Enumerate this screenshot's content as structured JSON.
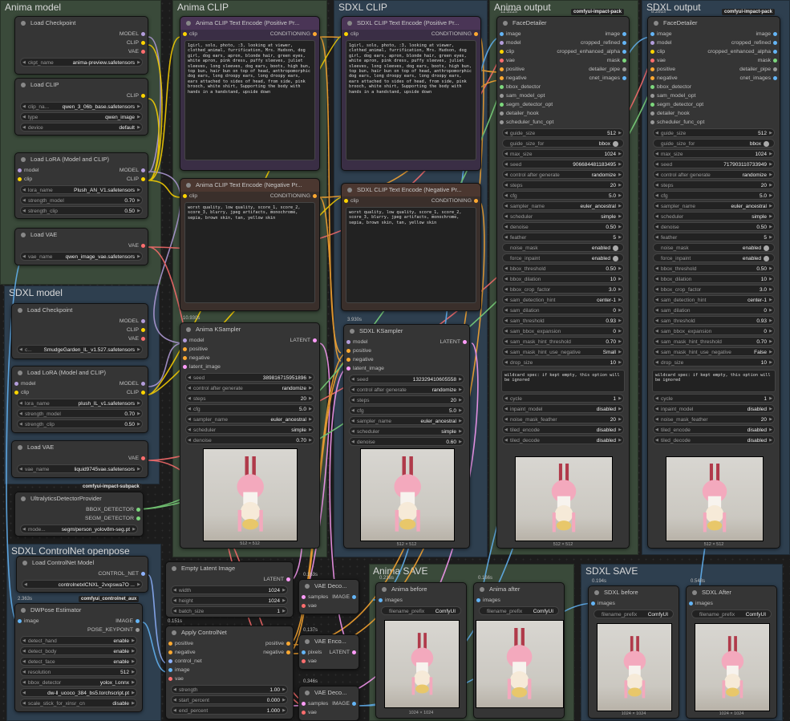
{
  "colors": {
    "model": "#b39ddb",
    "clip": "#ffd500",
    "vae": "#ff6e6e",
    "conditioning": "#ffa931",
    "latent": "#ff9cf9",
    "image": "#64b5f6",
    "bbox": "#7dd87d",
    "control": "#8fb3ff"
  },
  "groups": {
    "anima_model": "Anima model",
    "anima_clip": "Anima CLIP",
    "sdxl_clip": "SDXL CLIP",
    "anima_output": "Anima output",
    "sdxl_output": "SDXL output",
    "sdxl_model": "SDXL model",
    "sdxl_controlnet": "SDXL ControlNet openpose",
    "anima_save": "Anima SAVE",
    "sdxl_save": "SDXL SAVE"
  },
  "tags": {
    "impact_pack": "comfyui-impact-pack",
    "impact_subpack": "comfyui-impact-subpack",
    "controlnet_aux": "comfyui_controlnet_aux"
  },
  "times": {
    "anima_output": "11.522s",
    "sdxl_output": "8.281s",
    "anima_ks": "10.930s",
    "sdxl_ks": "3.930s",
    "dwpose": "2.363s",
    "ctrlnet": "0.151s",
    "vae1": "0.163s",
    "vae2": "0.137s",
    "vae3": "0.346s",
    "anima_before": "0.216s",
    "anima_after": "0.166s",
    "sdxl_before": "0.194s",
    "sdxl_after": "0.548s"
  },
  "am": {
    "ckpt_title": "Load Checkpoint",
    "ckpt_out": [
      "MODEL",
      "CLIP",
      "VAE"
    ],
    "ckpt_name_k": "ckpt_name",
    "ckpt_name_v": "anima-preview.safetensors",
    "clip_title": "Load CLIP",
    "clip_out": "CLIP",
    "clip_name_k": "clip_na...",
    "clip_name_v": "qwen_3_06b_base.safetensors",
    "type_k": "type",
    "type_v": "qwen_image",
    "device_k": "device",
    "device_v": "default",
    "lora_title": "Load LoRA (Model and CLIP)",
    "lora_in": [
      "model",
      "clip"
    ],
    "lora_out": [
      "MODEL",
      "CLIP"
    ],
    "lora_k": "lora_name",
    "lora_v": "Plush_AN_V1.safetensors",
    "sm_k": "strength_model",
    "sm_v": "0.70",
    "sc_k": "strength_clip",
    "sc_v": "0.50",
    "vae_title": "Load VAE",
    "vae_out": "VAE",
    "vae_k": "vae_name",
    "vae_v": "qwen_image_vae.safetensors"
  },
  "clip_a": {
    "pos_title": "Anima CLIP Text Encode (Positive Pr...",
    "neg_title": "Anima CLIP Text Encode (Negative Pr...",
    "in": "clip",
    "out": "CONDITIONING",
    "pos_text": "1girl, solo, photo, :3, looking at viewer, clothed_animal, furrification, Mrs. Hudson, dog girl, dog ears, apron, blonde hair, green eyes, white apron, pink dress, puffy sleeves, juliet sleeves, long sleeves, dog ears, boots, high bun, top bun, hair bun on top of head, anthropomorphic dog ears, long droopy ears, long droopy ears, ears attached to sides of head, from side, pink brooch, white shirt, Supporting the body with hands in a handstand, upside down",
    "neg_text": "worst quality, low quality, score_1, score_2, score_3, blurry, jpeg artifacts, monochrome, sepia, brown skin, tan, yellow skin"
  },
  "clip_s": {
    "pos_title": "SDXL CLIP Text Encode (Positive Pr...",
    "neg_title": "SDXL CLIP Text Encode (Negative Pr...",
    "in": "clip",
    "out": "CONDITIONING",
    "pos_text": "1girl, solo, photo, :3, looking at viewer, clothed_animal, furrification, Mrs. Hudson, dog girl, dog ears, apron, blonde hair, green eyes, white apron, pink dress, puffy sleeves, juliet sleeves, long sleeves, dog ears, boots, high bun, top bun, hair bun on top of head, anthropomorphic dog ears, long droopy ears, long droopy ears, ears attached to sides of head, from side, pink brooch, white shirt, Supporting the body with hands in a handstand, upside down",
    "neg_text": "worst quality, low quality, score_1, score_2, score_3, blurry, jpeg artifacts, monochrome, sepia, brown skin, tan, yellow skin"
  },
  "ks_a": {
    "title": "Anima KSampler",
    "inputs": [
      "model",
      "positive",
      "negative",
      "latent_image"
    ],
    "out": "LATENT",
    "w": [
      [
        "seed",
        "389816715951896"
      ],
      [
        "control after generate",
        "randomize"
      ],
      [
        "steps",
        "20"
      ],
      [
        "cfg",
        "5.0"
      ],
      [
        "sampler_name",
        "euler_ancestral"
      ],
      [
        "scheduler",
        "simple"
      ],
      [
        "denoise",
        "0.70"
      ]
    ],
    "cap": "512 × 512"
  },
  "ks_s": {
    "title": "SDXL KSampler",
    "inputs": [
      "model",
      "positive",
      "negative",
      "latent_image"
    ],
    "out": "LATENT",
    "w": [
      [
        "seed",
        "132329410605558"
      ],
      [
        "control after generate",
        "randomize"
      ],
      [
        "steps",
        "20"
      ],
      [
        "cfg",
        "5.0"
      ],
      [
        "sampler_name",
        "euler_ancestral"
      ],
      [
        "scheduler",
        "simple"
      ],
      [
        "denoise",
        "0.60"
      ]
    ],
    "cap": "512 × 512"
  },
  "fd": {
    "title": "FaceDetailer",
    "inputs": [
      "image",
      "model",
      "clip",
      "vae",
      "positive",
      "negative",
      "bbox_detector",
      "sam_model_opt",
      "segm_detector_opt",
      "detailer_hook",
      "scheduler_func_opt"
    ],
    "outputs": [
      "image",
      "cropped_refined",
      "cropped_enhanced_alpha",
      "mask",
      "detailer_pipe",
      "cnet_images"
    ],
    "w_a": [
      [
        "guide_size",
        "512"
      ],
      [
        "guide_size_for",
        "bbox"
      ],
      [
        "max_size",
        "1024"
      ],
      [
        "seed",
        "906684481183495"
      ],
      [
        "control after generate",
        "randomize"
      ],
      [
        "steps",
        "20"
      ],
      [
        "cfg",
        "5.0"
      ],
      [
        "sampler_name",
        "euler_ancestral"
      ],
      [
        "scheduler",
        "simple"
      ],
      [
        "denoise",
        "0.50"
      ],
      [
        "feather",
        "5"
      ],
      [
        "noise_mask",
        "enabled"
      ],
      [
        "force_inpaint",
        "enabled"
      ],
      [
        "bbox_threshold",
        "0.50"
      ],
      [
        "bbox_dilation",
        "10"
      ],
      [
        "bbox_crop_factor",
        "3.0"
      ],
      [
        "sam_detection_hint",
        "center-1"
      ],
      [
        "sam_dilation",
        "0"
      ],
      [
        "sam_threshold",
        "0.93"
      ],
      [
        "sam_bbox_expansion",
        "0"
      ],
      [
        "sam_mask_hint_threshold",
        "0.70"
      ],
      [
        "sam_mask_hint_use_negative",
        "Small"
      ],
      [
        "drop_size",
        "10"
      ]
    ],
    "w_s": [
      [
        "guide_size",
        "512"
      ],
      [
        "guide_size_for",
        "bbox"
      ],
      [
        "max_size",
        "1024"
      ],
      [
        "seed",
        "717903110733949"
      ],
      [
        "control after generate",
        "randomize"
      ],
      [
        "steps",
        "20"
      ],
      [
        "cfg",
        "5.0"
      ],
      [
        "sampler_name",
        "euler_ancestral"
      ],
      [
        "scheduler",
        "simple"
      ],
      [
        "denoise",
        "0.50"
      ],
      [
        "feather",
        "5"
      ],
      [
        "noise_mask",
        "enabled"
      ],
      [
        "force_inpaint",
        "enabled"
      ],
      [
        "bbox_threshold",
        "0.50"
      ],
      [
        "bbox_dilation",
        "10"
      ],
      [
        "bbox_crop_factor",
        "3.0"
      ],
      [
        "sam_detection_hint",
        "center-1"
      ],
      [
        "sam_dilation",
        "0"
      ],
      [
        "sam_threshold",
        "0.93"
      ],
      [
        "sam_bbox_expansion",
        "0"
      ],
      [
        "sam_mask_hint_threshold",
        "0.70"
      ],
      [
        "sam_mask_hint_use_negative",
        "False"
      ],
      [
        "drop_size",
        "10"
      ]
    ],
    "wildcard": "wildcard spec: if kept empty, this option will be ignored",
    "w2": [
      [
        "cycle",
        "1"
      ],
      [
        "inpaint_model",
        "disabled"
      ],
      [
        "noise_mask_feather",
        "20"
      ],
      [
        "tiled_encode",
        "disabled"
      ],
      [
        "tiled_decode",
        "disabled"
      ]
    ],
    "cap": "512 × 512"
  },
  "sm": {
    "ckpt_title": "Load Checkpoint",
    "ckpt_out": [
      "MODEL",
      "CLIP",
      "VAE"
    ],
    "ckpt_k": "c...",
    "ckpt_v": "SmudgeGarden_IL_v1.527.safetensors",
    "lora_title": "Load LoRA (Model and CLIP)",
    "lora_in": [
      "model",
      "clip"
    ],
    "lora_out": [
      "MODEL",
      "CLIP"
    ],
    "lora_k": "lora_name",
    "lora_v": "plush_IL_v1.safetensors",
    "sm_k": "strength_model",
    "sm_v": "0.70",
    "sc_k": "strength_clip",
    "sc_v": "0.50",
    "vae_title": "Load VAE",
    "vae_out": "VAE",
    "vae_k": "vae_name",
    "vae_v": "liquid9745vae.safetensors"
  },
  "ud": {
    "title": "UltralyticsDetectorProvider",
    "out": [
      "BBOX_DETECTOR",
      "SEGM_DETECTOR"
    ],
    "k": "mode...",
    "v": "segm/person_yolov8m-seg.pt"
  },
  "cn": {
    "title": "Load ControlNet Model",
    "out": "CONTROL_NET",
    "v": "controlnetxlCNXL_2vxpswa7O ..."
  },
  "dw": {
    "title": "DWPose Estimator",
    "in": "image",
    "out": [
      "IMAGE",
      "POSE_KEYPOINT"
    ],
    "w": [
      [
        "detect_hand",
        "enable"
      ],
      [
        "detect_body",
        "enable"
      ],
      [
        "detect_face",
        "enable"
      ],
      [
        "resolution",
        "512"
      ],
      [
        "bbox_detector",
        "yolox_l.onnx"
      ],
      [
        "",
        "dw-ll_ucoco_384_bs5.torchscript.pt"
      ],
      [
        "scale_stick_for_xinsr_cn",
        "disable"
      ]
    ]
  },
  "el": {
    "title": "Empty Latent Image",
    "out": "LATENT",
    "w": [
      [
        "width",
        "1024"
      ],
      [
        "height",
        "1024"
      ],
      [
        "batch_size",
        "1"
      ]
    ]
  },
  "ac": {
    "title": "Apply ControlNet",
    "in": [
      "positive",
      "negative",
      "control_net",
      "image",
      "vae"
    ],
    "out": [
      "positive",
      "negative"
    ],
    "w": [
      [
        "strength",
        "1.00"
      ],
      [
        "start_percent",
        "0.000"
      ],
      [
        "end_percent",
        "1.000"
      ]
    ]
  },
  "vd1": {
    "title": "VAE Deco...",
    "in": [
      "samples",
      "vae"
    ],
    "out": "IMAGE"
  },
  "ve": {
    "title": "VAE Enco...",
    "in": [
      "pixels",
      "vae"
    ],
    "out": "LATENT"
  },
  "vd2": {
    "title": "VAE Deco...",
    "in": [
      "samples",
      "vae"
    ],
    "out": "IMAGE"
  },
  "save": {
    "anima_before": "Anima before",
    "anima_after": "Anima after",
    "sdxl_before": "SDXL before",
    "sdxl_after": "SDXL After",
    "in": "images",
    "fk": "filename_prefix",
    "fv": "ComfyUI",
    "cap": "1024 × 1024"
  }
}
